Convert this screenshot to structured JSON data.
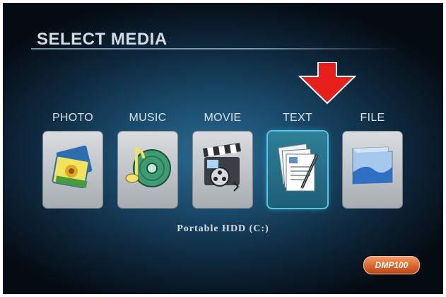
{
  "screen": {
    "title": "SELECT MEDIA",
    "location": "Portable HDD (C:)",
    "brand": "DMP100"
  },
  "media_items": [
    {
      "label": "PHOTO",
      "icon": "photo-icon",
      "selected": false
    },
    {
      "label": "MUSIC",
      "icon": "music-icon",
      "selected": false
    },
    {
      "label": "MOVIE",
      "icon": "movie-icon",
      "selected": false
    },
    {
      "label": "TEXT",
      "icon": "text-icon",
      "selected": true
    },
    {
      "label": "FILE",
      "icon": "file-icon",
      "selected": false
    }
  ],
  "colors": {
    "highlight_arrow": "#e8201c",
    "selection_border": "#58c4e0",
    "brand_badge": "#d8622a"
  }
}
